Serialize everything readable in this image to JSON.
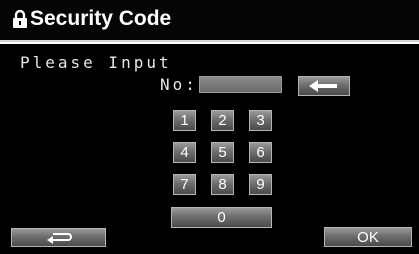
{
  "header": {
    "title": "Security Code",
    "icon": "lock-icon"
  },
  "prompt": {
    "text": "Please Input",
    "no_label": "No:",
    "no_value": ""
  },
  "keypad": {
    "keys": [
      "1",
      "2",
      "3",
      "4",
      "5",
      "6",
      "7",
      "8",
      "9"
    ],
    "zero": "0"
  },
  "buttons": {
    "backspace_icon": "left-arrow-icon",
    "back_icon": "return-icon",
    "ok_label": "OK"
  },
  "colors": {
    "background": "#000000",
    "button_top": "#9a9a9a",
    "button_bottom": "#4a4a4a",
    "text": "#ffffff"
  }
}
